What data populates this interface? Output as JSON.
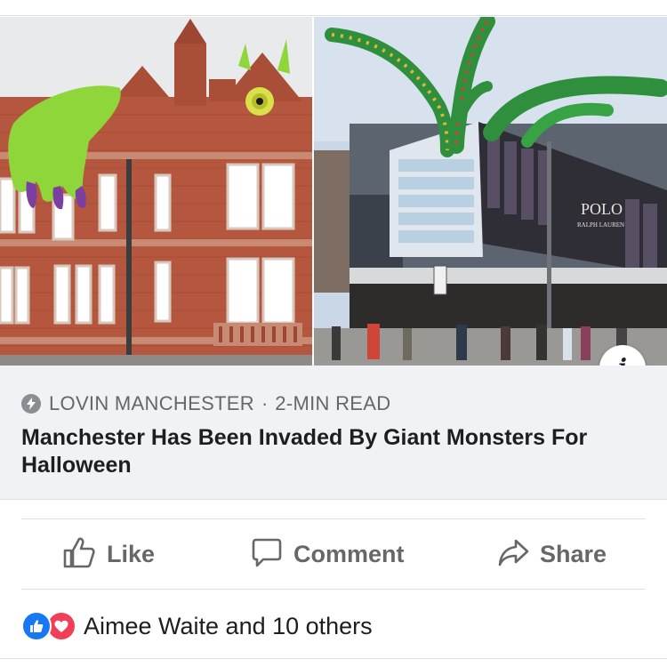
{
  "post": {
    "source": "LOVIN MANCHESTER",
    "separator": "·",
    "read_time": "2-MIN READ",
    "headline": "Manchester Has Been Invaded By Giant Monsters For Halloween",
    "images": {
      "left": "red brick building with giant green monster",
      "right": "shopping centre with giant green tentacles",
      "billboard_text": "POLO",
      "billboard_subtext": "RALPH LAUREN"
    }
  },
  "actions": {
    "like": "Like",
    "comment": "Comment",
    "share": "Share"
  },
  "reactions": {
    "summary": "Aimee Waite and 10 others"
  },
  "icons": {
    "info": "i"
  },
  "colors": {
    "brand_blue": "#1877f2",
    "love_red": "#f33e58",
    "muted_text": "#65676b",
    "link_box_bg": "#f0f2f5"
  }
}
